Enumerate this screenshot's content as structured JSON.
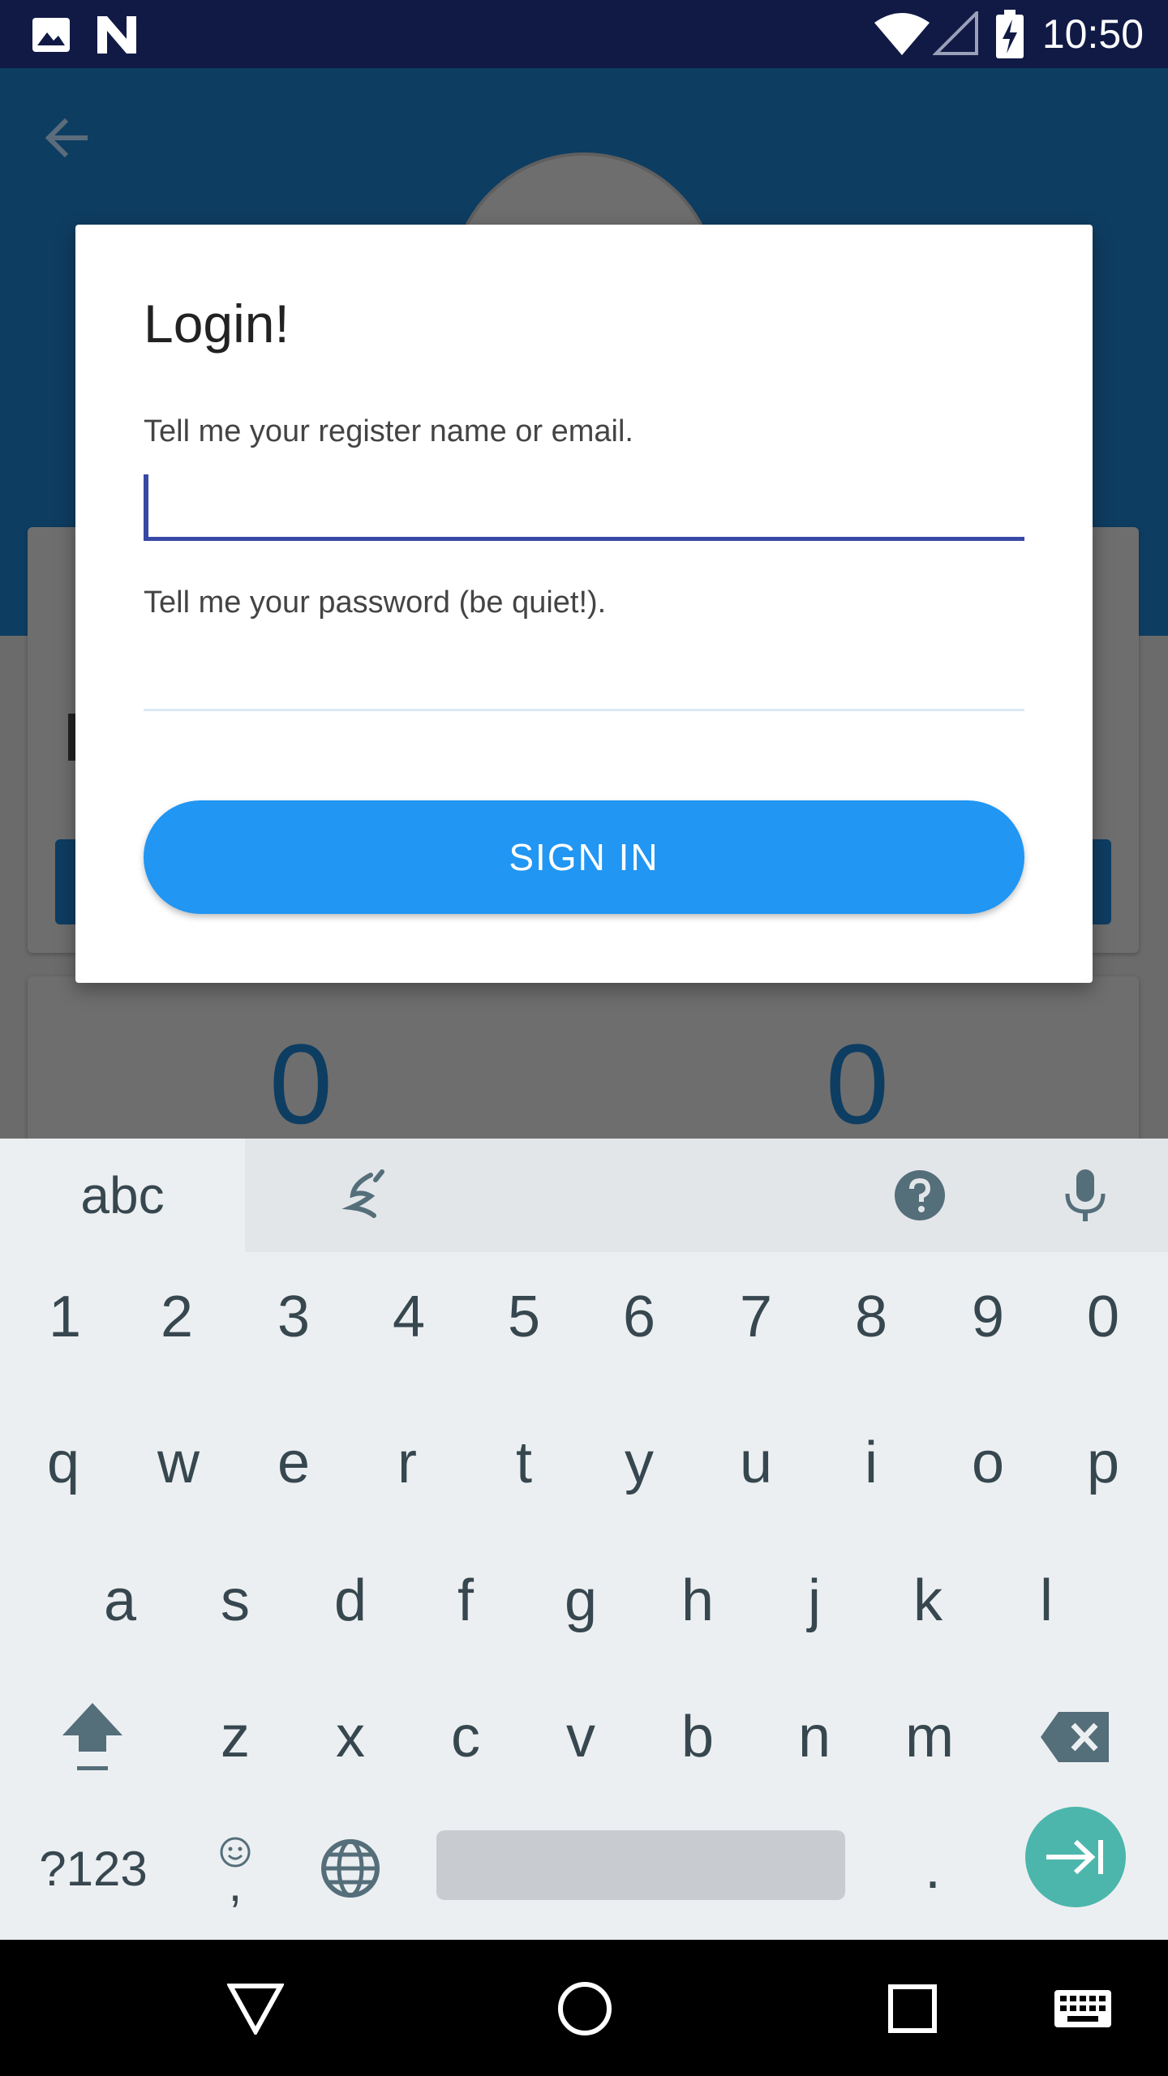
{
  "status_bar": {
    "time": "10:50",
    "icons": [
      "image-icon",
      "n-logo-icon",
      "wifi-icon",
      "signal-icon",
      "battery-charging-icon"
    ]
  },
  "background_app": {
    "stat_left": "0",
    "stat_right": "0",
    "colors": {
      "header": "#0e3d62",
      "dim": "#6b6b6b"
    }
  },
  "dialog": {
    "title": "Login!",
    "email_label": "Tell me your register name or email.",
    "email_value": "",
    "password_label": "Tell me your password (be quiet!).",
    "password_value": "",
    "sign_in_label": "SIGN IN",
    "colors": {
      "button": "#2196f3",
      "focus_underline": "#3848a5"
    }
  },
  "keyboard": {
    "tab_label": "abc",
    "toolbar_icons": [
      "handwriting-icon",
      "help-icon",
      "mic-icon"
    ],
    "number_row": [
      "1",
      "2",
      "3",
      "4",
      "5",
      "6",
      "7",
      "8",
      "9",
      "0"
    ],
    "row1": [
      "q",
      "w",
      "e",
      "r",
      "t",
      "y",
      "u",
      "i",
      "o",
      "p"
    ],
    "row2": [
      "a",
      "s",
      "d",
      "f",
      "g",
      "h",
      "j",
      "k",
      "l"
    ],
    "row3": [
      "z",
      "x",
      "c",
      "v",
      "b",
      "n",
      "m"
    ],
    "symbols_label": "?123",
    "period_label": ".",
    "emoji_comma_label": ",",
    "colors": {
      "enter": "#4db6ac",
      "key_text": "#37474f"
    }
  },
  "nav_bar": {
    "icons": [
      "back-triangle-icon",
      "home-circle-icon",
      "recents-square-icon",
      "keyboard-icon"
    ]
  }
}
